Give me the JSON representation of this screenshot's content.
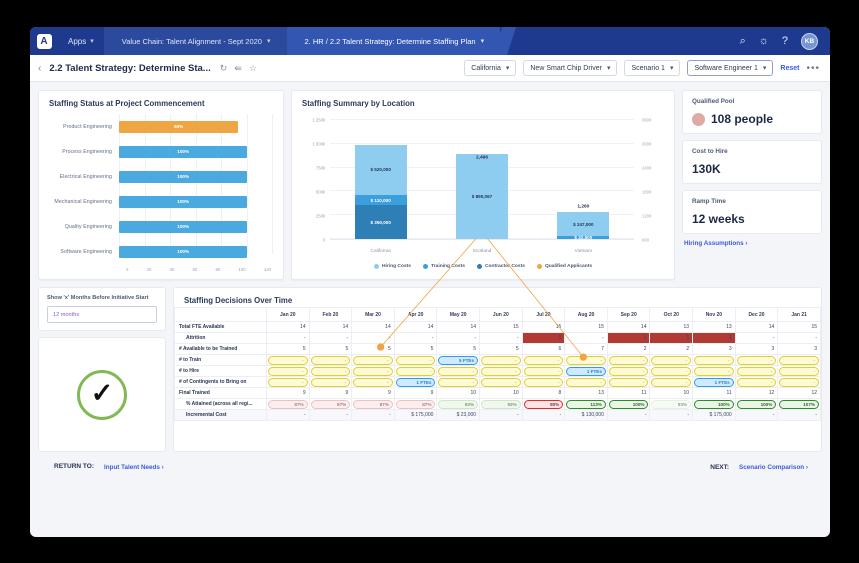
{
  "topnav": {
    "logo": "logo-mark",
    "apps_label": "Apps",
    "crumb1": "Value Chain: Talent Alignment - Sept 2020",
    "crumb2": "2. HR / 2.2 Talent Strategy: Determine Staffing Plan",
    "search_icon": "search-icon",
    "bell_icon": "bell-icon",
    "help_icon": "help-icon",
    "avatar_initials": "KB"
  },
  "subbar": {
    "back_icon": "chevron-left-icon",
    "title": "2.2 Talent Strategy: Determine Sta...",
    "refresh_icon": "refresh-icon",
    "share_icon": "share-icon",
    "star_icon": "star-icon",
    "filters": [
      {
        "label": "California",
        "active": false
      },
      {
        "label": "New Smart Chip Driver",
        "active": false
      },
      {
        "label": "Scenario 1",
        "active": false
      },
      {
        "label": "Software Engineer 1",
        "active": true
      }
    ],
    "reset_label": "Reset",
    "overflow_label": "•••"
  },
  "staffing_status": {
    "title": "Staffing Status at Project Commencement",
    "chart_data": {
      "type": "bar",
      "orientation": "horizontal",
      "title": "Staffing Status at Project Commencement",
      "categories": [
        "Product Engineering",
        "Process Engineering",
        "Electrical Engineering",
        "Mechanical Engineering",
        "Quality Engineering",
        "Software Engineering"
      ],
      "values": [
        93,
        100,
        100,
        100,
        100,
        100
      ],
      "labels": [
        "93%",
        "100%",
        "100%",
        "100%",
        "100%",
        "100%"
      ],
      "colors": [
        "#f0a543",
        "#4aaae0",
        "#4aaae0",
        "#4aaae0",
        "#4aaae0",
        "#4aaae0"
      ],
      "xlabel": "",
      "ylabel": "",
      "xlim": [
        0,
        120
      ],
      "xticks": [
        "0",
        "20",
        "40",
        "60",
        "80",
        "100",
        "120"
      ],
      "grid": true
    }
  },
  "staffing_summary": {
    "title": "Staffing Summary by Location",
    "chart_data": {
      "type": "bar",
      "subtype": "stacked-bar-with-line",
      "title": "Staffing Summary by Location",
      "categories": [
        "California",
        "Scotland",
        "Vietnam"
      ],
      "series": [
        {
          "name": "Hiring Costs",
          "color": "#8ecdf0",
          "values": [
            520000,
            890067,
            247000
          ],
          "labels": [
            "$ 520,000",
            "$ 890,067",
            "$ 247,000"
          ]
        },
        {
          "name": "Training Costs",
          "color": "#3b9fdc",
          "values": [
            110000,
            0,
            32500
          ],
          "labels": [
            "$ 110,000",
            "",
            "$ 32,500"
          ]
        },
        {
          "name": "Contractor Costs",
          "color": "#2e7fb5",
          "values": [
            350000,
            0,
            0
          ],
          "labels": [
            "$ 350,000",
            "",
            ""
          ]
        }
      ],
      "line_series": {
        "name": "Qualified Applicants",
        "color": "#f0a543",
        "values": [
          1360,
          2496,
          1260
        ],
        "labels": [
          "",
          "2,496",
          "1,260"
        ],
        "axis": "right"
      },
      "ylabel": "",
      "xlabel": "",
      "ylim": [
        0,
        1250000
      ],
      "yticks": [
        "0",
        "250k",
        "500k",
        "750k",
        "1 000k",
        "1 250k"
      ],
      "y2lim": [
        600,
        3600
      ],
      "y2ticks": [
        "600",
        "1200",
        "1800",
        "2400",
        "3000",
        "3600"
      ],
      "legend": [
        "Hiring Costs",
        "Training Costs",
        "Contractor Costs",
        "Qualified Applicants"
      ],
      "legend_position": "bottom",
      "grid": true
    }
  },
  "kpis": [
    {
      "label": "Qualified Pool",
      "value": "108 people",
      "has_dot": true,
      "dot_color": "#deaaa4"
    },
    {
      "label": "Cost to Hire",
      "value": "130K",
      "has_dot": false
    },
    {
      "label": "Ramp Time",
      "value": "12 weeks",
      "has_dot": false
    }
  ],
  "hiring_assumptions_link": "Hiring Assumptions ",
  "months_panel": {
    "label": "Show 'x' Months Before Initiative Start",
    "value": "12 months",
    "placeholder": "12 months"
  },
  "status_check": {
    "icon": "check-circle-icon",
    "color": "#82b956"
  },
  "table": {
    "title": "Staffing Decisions Over Time",
    "columns": [
      "",
      "Jan 20",
      "Feb 20",
      "Mar 20",
      "Apr 20",
      "May 20",
      "Jun 20",
      "Jul 20",
      "Aug 20",
      "Sep 20",
      "Oct 20",
      "Nov 20",
      "Dec 20",
      "Jan 21"
    ],
    "rows": [
      {
        "label": "Total FTE Available",
        "indent": false,
        "style": "plain",
        "alt": false,
        "cells": [
          {
            "t": "14"
          },
          {
            "t": "14"
          },
          {
            "t": "14"
          },
          {
            "t": "14"
          },
          {
            "t": "14"
          },
          {
            "t": "15"
          },
          {
            "t": "15"
          },
          {
            "t": "15"
          },
          {
            "t": "14"
          },
          {
            "t": "13"
          },
          {
            "t": "13"
          },
          {
            "t": "14"
          },
          {
            "t": "15"
          }
        ]
      },
      {
        "label": "Attrition",
        "indent": true,
        "style": "plain",
        "alt": false,
        "cells": [
          {
            "t": "-"
          },
          {
            "t": "-"
          },
          {
            "t": "-"
          },
          {
            "t": "-"
          },
          {
            "t": "-"
          },
          {
            "t": "-"
          },
          {
            "t": "1",
            "c": "cell-attr"
          },
          {
            "t": "-"
          },
          {
            "t": "1",
            "c": "cell-attr"
          },
          {
            "t": "1",
            "c": "cell-attr"
          },
          {
            "t": "1",
            "c": "cell-attr"
          },
          {
            "t": "-"
          },
          {
            "t": "-"
          }
        ]
      },
      {
        "label": "# Available to be Trained",
        "indent": false,
        "style": "plain",
        "alt": false,
        "cells": [
          {
            "t": "5"
          },
          {
            "t": "5"
          },
          {
            "t": "5"
          },
          {
            "t": "5"
          },
          {
            "t": "5"
          },
          {
            "t": "5"
          },
          {
            "t": "6"
          },
          {
            "t": "7"
          },
          {
            "t": "2"
          },
          {
            "t": "2"
          },
          {
            "t": "3"
          },
          {
            "t": "3"
          },
          {
            "t": "3"
          }
        ]
      },
      {
        "label": "# to Train",
        "indent": false,
        "style": "pill",
        "alt": false,
        "cells": [
          {
            "t": "-",
            "p": "p-yellow"
          },
          {
            "t": "-",
            "p": "p-yellow"
          },
          {
            "t": "-",
            "p": "p-yellow"
          },
          {
            "t": "-",
            "p": "p-yellow"
          },
          {
            "t": "5 FTEs",
            "p": "p-blue"
          },
          {
            "t": "-",
            "p": "p-yellow"
          },
          {
            "t": "-",
            "p": "p-yellow"
          },
          {
            "t": "-",
            "p": "p-yellow"
          },
          {
            "t": "-",
            "p": "p-yellow"
          },
          {
            "t": "-",
            "p": "p-yellow"
          },
          {
            "t": "-",
            "p": "p-yellow"
          },
          {
            "t": "-",
            "p": "p-yellow"
          },
          {
            "t": "-",
            "p": "p-yellow"
          }
        ]
      },
      {
        "label": "# to Hire",
        "indent": false,
        "style": "pill",
        "alt": false,
        "cells": [
          {
            "t": "-",
            "p": "p-yellow"
          },
          {
            "t": "-",
            "p": "p-yellow"
          },
          {
            "t": "-",
            "p": "p-yellow"
          },
          {
            "t": "-",
            "p": "p-yellow"
          },
          {
            "t": "-",
            "p": "p-yellow"
          },
          {
            "t": "-",
            "p": "p-yellow"
          },
          {
            "t": "-",
            "p": "p-yellow"
          },
          {
            "t": "1 FTEs",
            "p": "p-blue"
          },
          {
            "t": "-",
            "p": "p-yellow"
          },
          {
            "t": "-",
            "p": "p-yellow"
          },
          {
            "t": "-",
            "p": "p-yellow"
          },
          {
            "t": "-",
            "p": "p-yellow"
          },
          {
            "t": "-",
            "p": "p-yellow"
          }
        ]
      },
      {
        "label": "# of Contingents to Bring on",
        "indent": false,
        "style": "pill",
        "alt": false,
        "cells": [
          {
            "t": "-",
            "p": "p-yellow"
          },
          {
            "t": "-",
            "p": "p-yellow"
          },
          {
            "t": "-",
            "p": "p-yellow"
          },
          {
            "t": "1 FTEs",
            "p": "p-blue"
          },
          {
            "t": "-",
            "p": "p-yellow"
          },
          {
            "t": "-",
            "p": "p-yellow"
          },
          {
            "t": "-",
            "p": "p-yellow"
          },
          {
            "t": "-",
            "p": "p-yellow"
          },
          {
            "t": "-",
            "p": "p-yellow"
          },
          {
            "t": "-",
            "p": "p-yellow"
          },
          {
            "t": "1 FTEs",
            "p": "p-blue"
          },
          {
            "t": "-",
            "p": "p-yellow"
          },
          {
            "t": "-",
            "p": "p-yellow"
          }
        ]
      },
      {
        "label": "Final Trained",
        "indent": false,
        "style": "plain",
        "alt": false,
        "cells": [
          {
            "t": "9"
          },
          {
            "t": "9"
          },
          {
            "t": "9"
          },
          {
            "t": "9"
          },
          {
            "t": "10"
          },
          {
            "t": "10"
          },
          {
            "t": "8"
          },
          {
            "t": "13"
          },
          {
            "t": "11"
          },
          {
            "t": "10"
          },
          {
            "t": "11"
          },
          {
            "t": "12"
          },
          {
            "t": "12"
          }
        ]
      },
      {
        "label": "% Attained (across all regi...",
        "indent": true,
        "style": "pill",
        "alt": false,
        "cells": [
          {
            "t": "87%",
            "p": "p-redline"
          },
          {
            "t": "87%",
            "p": "p-redline"
          },
          {
            "t": "87%",
            "p": "p-redline"
          },
          {
            "t": "87%",
            "p": "p-redline"
          },
          {
            "t": "93%",
            "p": "p-greenline"
          },
          {
            "t": "93%",
            "p": "p-greenline"
          },
          {
            "t": "80%",
            "p": "p-redstrong"
          },
          {
            "t": "113%",
            "p": "p-greenstrong"
          },
          {
            "t": "100%",
            "p": "p-greenstrong"
          },
          {
            "t": "93%",
            "p": "p-greenfaint"
          },
          {
            "t": "100%",
            "p": "p-greenstrong"
          },
          {
            "t": "100%",
            "p": "p-greenstrong"
          },
          {
            "t": "107%",
            "p": "p-greenstrong"
          }
        ]
      },
      {
        "label": "Incremental Cost",
        "indent": true,
        "style": "plain",
        "alt": true,
        "cells": [
          {
            "t": "-"
          },
          {
            "t": "-"
          },
          {
            "t": "-"
          },
          {
            "t": "$ 175,000"
          },
          {
            "t": "$ 23,000"
          },
          {
            "t": "-"
          },
          {
            "t": "-"
          },
          {
            "t": "$ 130,000"
          },
          {
            "t": "-"
          },
          {
            "t": "-"
          },
          {
            "t": "$ 175,000"
          },
          {
            "t": "-"
          },
          {
            "t": "-"
          }
        ]
      }
    ]
  },
  "footer": {
    "return_label": "RETURN TO:",
    "return_link": "Input Talent Needs ",
    "next_label": "NEXT:",
    "next_link": "Scenario Comparison "
  }
}
